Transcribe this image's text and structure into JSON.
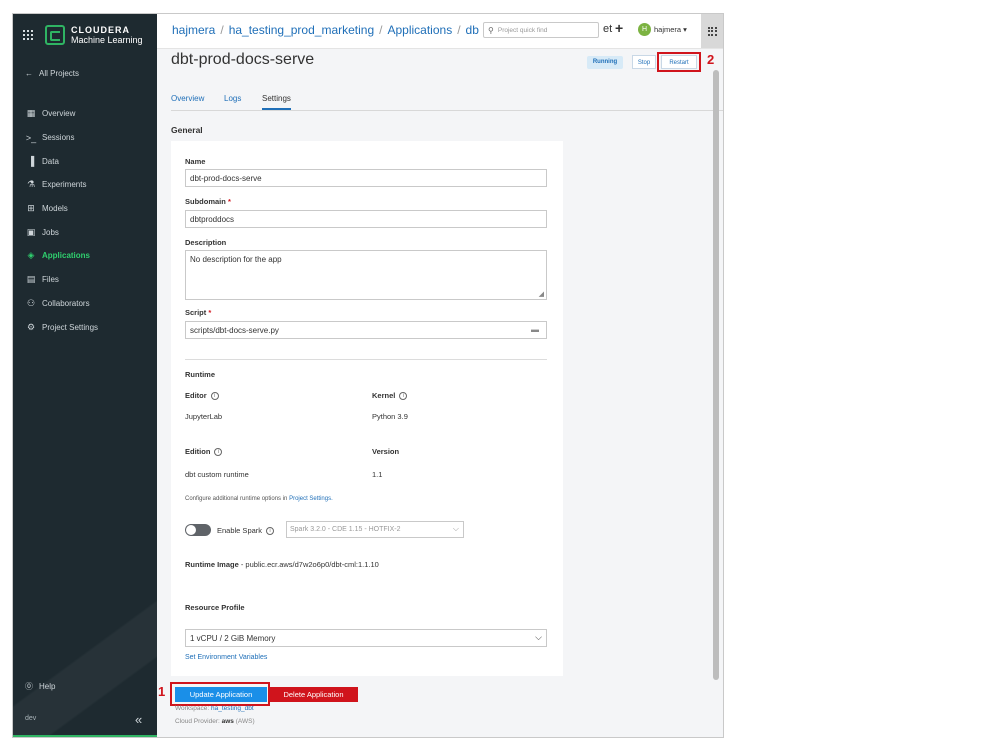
{
  "sidebar": {
    "brand_line1": "CLOUDERA",
    "brand_line2": "Machine Learning",
    "back_label": "All Projects",
    "items": [
      {
        "label": "Overview",
        "icon": "overview-icon",
        "glyph": "▦"
      },
      {
        "label": "Sessions",
        "icon": "terminal-icon",
        "glyph": ">_"
      },
      {
        "label": "Data",
        "icon": "bar-chart-icon",
        "glyph": "▐"
      },
      {
        "label": "Experiments",
        "icon": "flask-icon",
        "glyph": "⚗"
      },
      {
        "label": "Models",
        "icon": "models-icon",
        "glyph": "⊞"
      },
      {
        "label": "Jobs",
        "icon": "jobs-icon",
        "glyph": "▣"
      },
      {
        "label": "Applications",
        "icon": "applications-icon",
        "glyph": "◈",
        "active": true
      },
      {
        "label": "Files",
        "icon": "file-icon",
        "glyph": "▤"
      },
      {
        "label": "Collaborators",
        "icon": "collaborators-icon",
        "glyph": "⚇"
      },
      {
        "label": "Project Settings",
        "icon": "settings-icon",
        "glyph": "⚙"
      }
    ],
    "help_label": "Help",
    "env_label": "dev",
    "accent": "#2fcf6e"
  },
  "topbar": {
    "crumb_user": "hajmera",
    "crumb_project": "ha_testing_prod_marketing",
    "crumb_section": "Applications",
    "crumb_app": "db",
    "search_placeholder": "Project quick find",
    "overlap_text": "et",
    "avatar_letter": "H",
    "user_label": "hajmera ▾"
  },
  "header": {
    "title": "dbt-prod-docs-serve",
    "status": "Running",
    "stop_label": "Stop",
    "restart_label": "Restart",
    "annotation_2": "2"
  },
  "tabs": [
    {
      "label": "Overview"
    },
    {
      "label": "Logs"
    },
    {
      "label": "Settings",
      "active": true
    }
  ],
  "form": {
    "section_title": "General",
    "name_label": "Name",
    "name_value": "dbt-prod-docs-serve",
    "subdomain_label": "Subdomain",
    "subdomain_value": "dbtproddocs",
    "description_label": "Description",
    "description_value": "No description for the app",
    "script_label": "Script",
    "script_value": "scripts/dbt-docs-serve.py",
    "required_mark": "*",
    "runtime_title": "Runtime",
    "editor_label": "Editor",
    "editor_value": "JupyterLab",
    "kernel_label": "Kernel",
    "kernel_value": "Python 3.9",
    "edition_label": "Edition",
    "edition_value": "dbt custom runtime",
    "version_label": "Version",
    "version_value": "1.1",
    "config_text": "Configure additional runtime options in ",
    "config_link": "Project Settings.",
    "spark_label": "Enable Spark",
    "spark_option": "Spark 3.2.0 - CDE 1.15 - HOTFIX-2",
    "runtime_image_label": "Runtime Image",
    "runtime_image_value": " - public.ecr.aws/d7w2o6p0/dbt-cml:1.1.10",
    "resource_label": "Resource Profile",
    "resource_value": "1 vCPU / 2 GiB Memory",
    "env_vars_link": "Set Environment Variables"
  },
  "footer": {
    "update_label": "Update Application",
    "delete_label": "Delete Application",
    "annotation_1": "1",
    "workspace_label": "Workspace: ",
    "workspace_value": "ha_testing_dbt",
    "cloud_label": "Cloud Provider: ",
    "cloud_value": "aws",
    "cloud_suffix": " (AWS)"
  },
  "colors": {
    "link": "#1f6fb8",
    "primary_button": "#1a8fe8",
    "danger": "#d0141c",
    "sidebar_bg": "#1e2a30"
  }
}
